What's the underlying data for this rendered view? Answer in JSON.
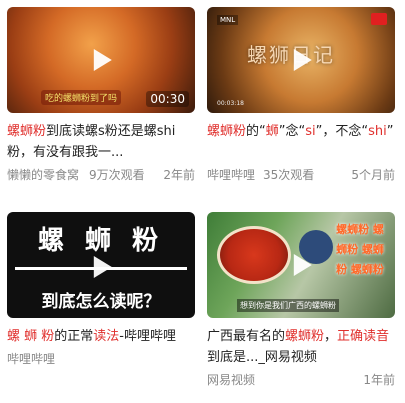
{
  "cards": [
    {
      "duration": "00:30",
      "thumb_caption": "吃的螺蛳粉到了吗",
      "title_parts": [
        {
          "text": "螺蛳粉",
          "hl": true
        },
        {
          "text": "到底读螺s粉还是螺shi粉，有没有跟我一...",
          "hl": false
        }
      ],
      "source": "懒懒的零食窝",
      "views": "9万次观看",
      "time": "2年前"
    },
    {
      "brand": "MNL",
      "thumb_title": "螺狮日记",
      "thumb_tag": "00:03:18",
      "title_parts": [
        {
          "text": "螺蛳粉",
          "hl": true
        },
        {
          "text": "的“",
          "hl": false
        },
        {
          "text": "蛳",
          "hl": true
        },
        {
          "text": "”念“",
          "hl": false
        },
        {
          "text": "si",
          "hl": true
        },
        {
          "text": "”，不念“",
          "hl": false
        },
        {
          "text": "shi",
          "hl": true
        },
        {
          "text": "”",
          "hl": false
        }
      ],
      "source": "哔哩哔哩",
      "views": "35次观看",
      "time": "5个月前"
    },
    {
      "thumb_top": "螺 蛳 粉",
      "thumb_bottom": "到底怎么读呢？",
      "title_parts": [
        {
          "text": "螺 蛳 粉",
          "hl": true
        },
        {
          "text": "的正常",
          "hl": false
        },
        {
          "text": "读法",
          "hl": true
        },
        {
          "text": "-哔哩哔哩",
          "hl": false
        }
      ],
      "source": "哔哩哔哩",
      "views": "",
      "time": ""
    },
    {
      "thumb_sign": "螺蛳粉 螺蛳粉 螺蛳粉 螺蛳粉",
      "thumb_caption": "想到你是我们广西的螺蛳粉",
      "title_parts": [
        {
          "text": "广西最有名的",
          "hl": false
        },
        {
          "text": "螺蛳粉",
          "hl": true
        },
        {
          "text": "，",
          "hl": false
        },
        {
          "text": "正确读音",
          "hl": true
        },
        {
          "text": "到底是..._网易视频",
          "hl": false
        }
      ],
      "source": "网易视频",
      "views": "",
      "time": "1年前"
    }
  ],
  "colors": {
    "highlight": "#e0302d",
    "meta": "#888888",
    "title": "#222222"
  },
  "icons": {
    "play": "play-icon"
  }
}
